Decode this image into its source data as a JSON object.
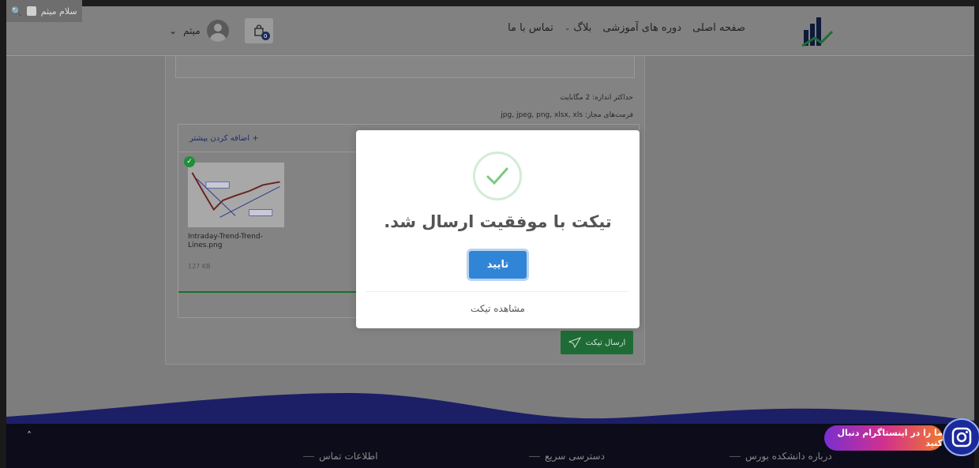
{
  "admin_bar": {
    "greeting": "سلام میثم"
  },
  "header": {
    "nav": [
      {
        "label": "صفحه اصلی",
        "has_dropdown": false
      },
      {
        "label": "دوره های آموزشی",
        "has_dropdown": false
      },
      {
        "label": "بلاگ",
        "has_dropdown": true
      },
      {
        "label": "تماس با ما",
        "has_dropdown": false
      }
    ],
    "user_name": "میثم",
    "cart_count": "0"
  },
  "form": {
    "max_size": "حداکثر اندازه: 2 مگابایت",
    "allowed_formats": "فرمت‌های مجاز: jpg, jpeg, png, xlsx, xls",
    "add_more": "+ اضافه کردن بیشتر",
    "file": {
      "name": "Intraday-Trend-Trend-Lines.png",
      "size": "127 KB"
    },
    "send_label": "ارسال تیکت"
  },
  "modal": {
    "title": "تیکت با موفقیت ارسال شد.",
    "confirm_label": "تایید",
    "view_ticket_label": "مشاهده تیکت"
  },
  "footer": {
    "headings": [
      "درباره دانشکده بورس",
      "دسترسی سریع",
      "اطلاعات تماس"
    ]
  },
  "instagram_promo": {
    "label": "ما را در اینستاگرام دنبال کنید"
  },
  "colors": {
    "confirm_button": "#3085d6",
    "success_check": "#7cc97f",
    "send_button": "#1f6b36",
    "footer_bg": "#0c0c1a"
  }
}
